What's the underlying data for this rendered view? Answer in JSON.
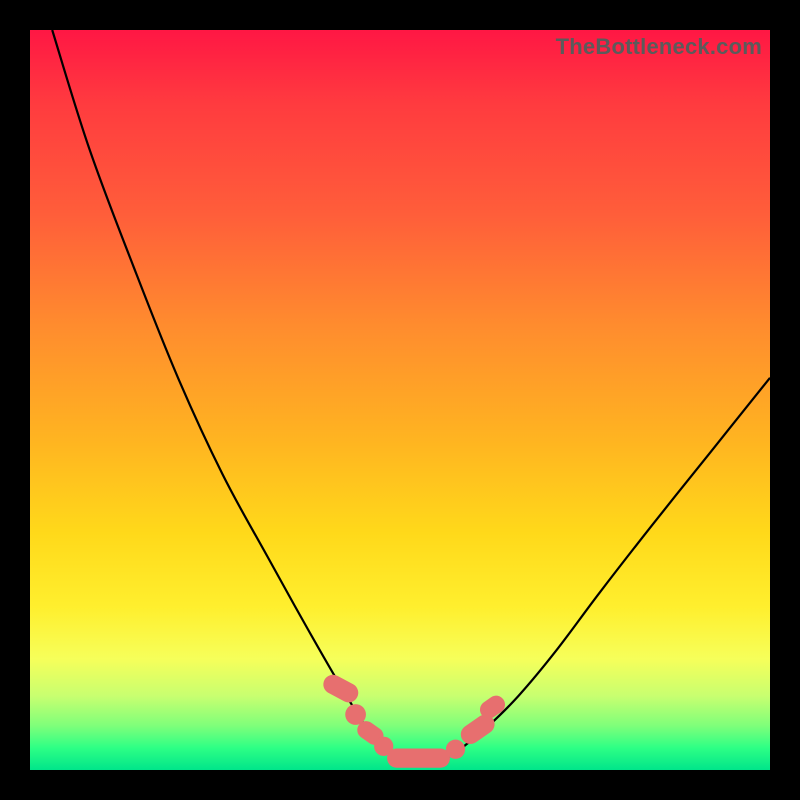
{
  "watermark": "TheBottleneck.com",
  "colors": {
    "frame": "#000000",
    "gradient_top": "#ff1744",
    "gradient_mid": "#ffd91a",
    "gradient_bottom": "#00e58a",
    "curve": "#000000",
    "marker": "#e76f6f"
  },
  "chart_data": {
    "type": "line",
    "title": "",
    "xlabel": "",
    "ylabel": "",
    "xlim": [
      0,
      100
    ],
    "ylim": [
      0,
      100
    ],
    "grid": false,
    "legend": false,
    "series": [
      {
        "name": "left-branch",
        "x": [
          3,
          8,
          14,
          20,
          26,
          32,
          37,
          41,
          44,
          46,
          48,
          49,
          50
        ],
        "y": [
          100,
          84,
          68,
          53,
          40,
          29,
          20,
          13,
          8,
          5,
          3,
          2,
          1.5
        ]
      },
      {
        "name": "right-branch",
        "x": [
          55,
          57,
          59,
          62,
          66,
          71,
          77,
          84,
          92,
          100
        ],
        "y": [
          1.5,
          2,
          3.5,
          6,
          10,
          16,
          24,
          33,
          43,
          53
        ]
      },
      {
        "name": "valley-floor",
        "x": [
          50,
          51,
          52,
          53,
          54,
          55
        ],
        "y": [
          1.5,
          1.2,
          1.1,
          1.1,
          1.2,
          1.5
        ]
      }
    ],
    "markers": [
      {
        "shape": "pill",
        "cx": 42.0,
        "cy": 11.0,
        "w": 2.6,
        "h": 5.0,
        "angle": -62
      },
      {
        "shape": "round",
        "cx": 44.0,
        "cy": 7.5,
        "r": 1.4
      },
      {
        "shape": "pill",
        "cx": 46.0,
        "cy": 5.0,
        "w": 2.4,
        "h": 3.8,
        "angle": -55
      },
      {
        "shape": "round",
        "cx": 47.8,
        "cy": 3.2,
        "r": 1.3
      },
      {
        "shape": "pill",
        "cx": 52.5,
        "cy": 1.6,
        "w": 8.5,
        "h": 2.6,
        "angle": 0
      },
      {
        "shape": "round",
        "cx": 57.5,
        "cy": 2.8,
        "r": 1.3
      },
      {
        "shape": "pill",
        "cx": 60.5,
        "cy": 5.5,
        "w": 2.6,
        "h": 5.0,
        "angle": 55
      },
      {
        "shape": "pill",
        "cx": 62.5,
        "cy": 8.5,
        "w": 2.4,
        "h": 3.6,
        "angle": 55
      }
    ],
    "annotations": []
  }
}
